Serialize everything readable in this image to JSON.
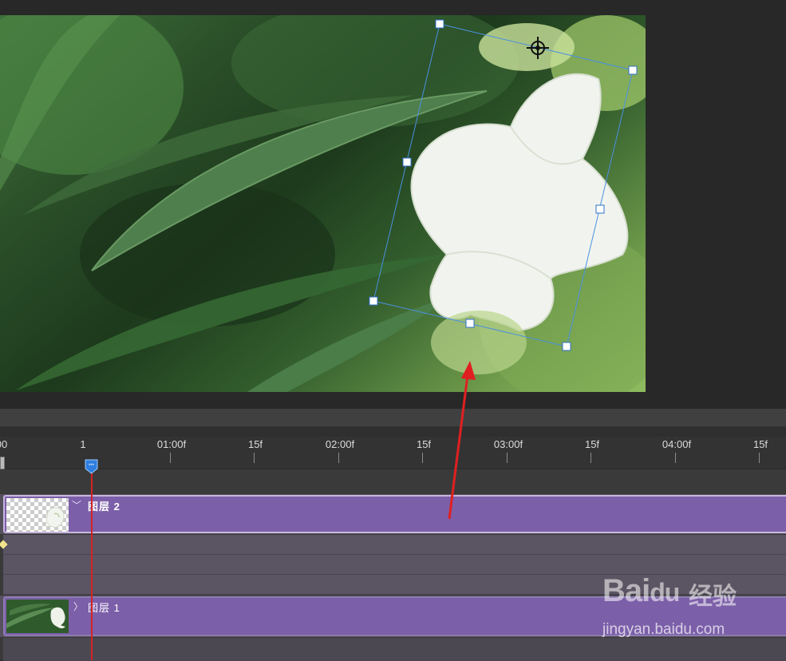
{
  "timeline": {
    "ruler_labels": [
      "00",
      "1",
      "01:00f",
      "15f",
      "02:00f",
      "15f",
      "03:00f",
      "15f",
      "04:00f",
      "15f"
    ],
    "playhead_badge": "***"
  },
  "layers": [
    {
      "name": "图层 2",
      "chevron": "﹀",
      "expanded": true
    },
    {
      "name": "图层 1",
      "chevron": "〉",
      "expanded": false
    }
  ],
  "watermark": {
    "brand": "Bai",
    "paw": "du",
    "cn": "经验",
    "url": "jingyan.baidu.com"
  },
  "colors": {
    "clip_purple": "#7c5fa9",
    "bounding_box": "#4a90e2",
    "playhead": "#d42424",
    "annotation_arrow": "#e02020"
  },
  "icons": [
    "anchor-point-icon",
    "playhead-icon",
    "keyframe-icon",
    "chevron-down-icon",
    "chevron-right-icon"
  ]
}
